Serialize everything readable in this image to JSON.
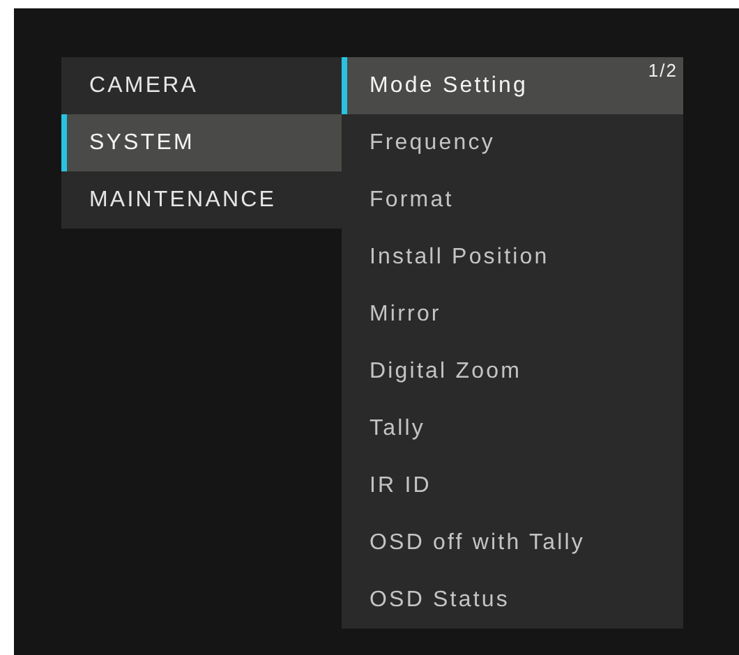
{
  "category_menu": {
    "items": [
      {
        "label": "CAMERA",
        "selected": false
      },
      {
        "label": "SYSTEM",
        "selected": true
      },
      {
        "label": "MAINTENANCE",
        "selected": false
      }
    ]
  },
  "system_menu": {
    "page": "1/2",
    "items": [
      {
        "label": "Mode Setting",
        "selected": true
      },
      {
        "label": "Frequency",
        "selected": false
      },
      {
        "label": "Format",
        "selected": false
      },
      {
        "label": "Install Position",
        "selected": false
      },
      {
        "label": "Mirror",
        "selected": false
      },
      {
        "label": "Digital Zoom",
        "selected": false
      },
      {
        "label": "Tally",
        "selected": false
      },
      {
        "label": "IR ID",
        "selected": false
      },
      {
        "label": "OSD off with Tally",
        "selected": false
      },
      {
        "label": "OSD Status",
        "selected": false
      }
    ]
  }
}
